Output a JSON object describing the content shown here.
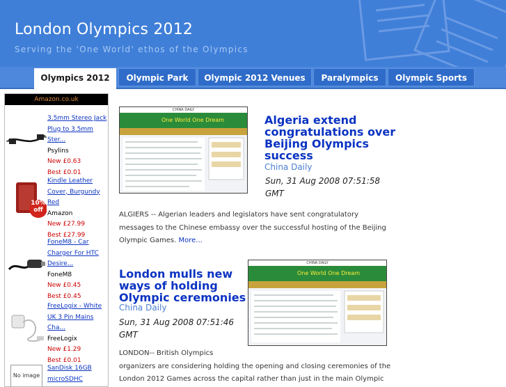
{
  "header": {
    "title": "London Olympics 2012",
    "tagline": "Serving the 'One World' ethos of the Olympics"
  },
  "nav": {
    "tabs": [
      {
        "label": "Olympics 2012",
        "active": true
      },
      {
        "label": "Olympic Park",
        "active": false
      },
      {
        "label": "Olympic 2012 Venues",
        "active": false
      },
      {
        "label": "Paralympics",
        "active": false
      },
      {
        "label": "Olympic Sports",
        "active": false
      }
    ]
  },
  "sidebar": {
    "heading": "Amazon.co.uk",
    "products": [
      {
        "title_lines": [
          "3.5mm Stereo Jack",
          "Plug to 3.5mm",
          "Ster..."
        ],
        "brand": "Psylins",
        "new_price": "New £0.63",
        "best_price": "Best £0.01",
        "icon": "audio-cable-icon"
      },
      {
        "title_lines": [
          "Kindle Leather",
          "Cover, Burgundy",
          "Red"
        ],
        "brand": "Amazon",
        "new_price": "New £27.99",
        "best_price": "Best £27.99",
        "icon": "kindle-cover-icon",
        "badge": "10% off"
      },
      {
        "title_lines": [
          "FoneM8 - Car",
          "Charger For HTC",
          "Desire..."
        ],
        "brand": "FoneM8",
        "new_price": "New £0.45",
        "best_price": "Best £0.45",
        "icon": "car-charger-icon"
      },
      {
        "title_lines": [
          "FreeLogix - White",
          "UK 3 Pin Mains",
          "Cha..."
        ],
        "brand": "FreeLogix",
        "new_price": "New £1.29",
        "best_price": "Best £0.01",
        "icon": "mains-charger-icon"
      },
      {
        "title_lines": [
          "SanDisk 16GB",
          "microSDHC"
        ],
        "brand": "",
        "new_price": "",
        "best_price": "",
        "icon": "no-image-icon",
        "no_image_label": "No image"
      }
    ]
  },
  "articles": [
    {
      "title_lines": [
        "Algeria extend",
        "congratulations over",
        "Beijing Olympics",
        "success"
      ],
      "source": "China Daily",
      "date_lines": [
        "Sun, 31 Aug 2008 07:51:58",
        "GMT"
      ],
      "body_lines": [
        "ALGIERS -- Algerian leaders and legislators have sent congratulatory",
        "messages to the Chinese embassy over the successful hosting of the Beijing",
        "Olympic Games."
      ],
      "more": "More...",
      "thumb_banner": "One World One Dream",
      "thumb_header": "CHINA DAILY"
    },
    {
      "title_lines": [
        "London mulls new",
        "ways of holding",
        "Olympic ceremonies"
      ],
      "source": "China Daily",
      "date_lines": [
        "Sun, 31 Aug 2008 07:51:46",
        "GMT"
      ],
      "body_lines": [
        "LONDON-- British Olympics",
        "organizers are considering holding the opening and closing ceremonies of the",
        "London 2012 Games across the capital rather than just in the main Olympic"
      ],
      "thumb_banner": "One World One Dream",
      "thumb_header": "CHINA DAILY"
    }
  ],
  "colors": {
    "header_bg": "#3f7fd8",
    "nav_tab_bg": "#2f6cc9",
    "link": "#0b33c2",
    "source": "#4b7fd1",
    "price": "#cc0000"
  }
}
